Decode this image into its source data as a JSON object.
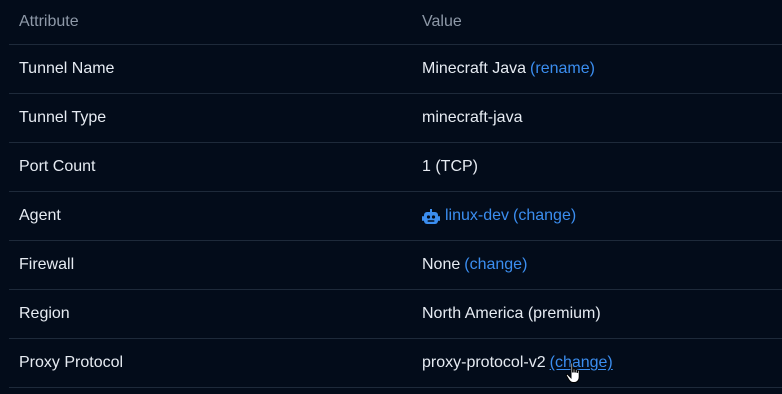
{
  "header": {
    "attribute": "Attribute",
    "value": "Value"
  },
  "rows": [
    {
      "attribute": "Tunnel Name",
      "value": "Minecraft Java",
      "action": "(rename)"
    },
    {
      "attribute": "Tunnel Type",
      "value": "minecraft-java"
    },
    {
      "attribute": "Port Count",
      "value": "1 (TCP)"
    },
    {
      "attribute": "Agent",
      "icon": "robot-icon",
      "value": "linux-dev",
      "action": "(change)"
    },
    {
      "attribute": "Firewall",
      "value": "None",
      "action": "(change)"
    },
    {
      "attribute": "Region",
      "value": "North America (premium)"
    },
    {
      "attribute": "Proxy Protocol",
      "value": "proxy-protocol-v2",
      "action": "(change)"
    }
  ],
  "colors": {
    "background": "#030c1a",
    "link": "#3b8ef0",
    "text": "#e6ebf2",
    "muted": "#8e99a8",
    "divider": "#1e2a3a"
  }
}
